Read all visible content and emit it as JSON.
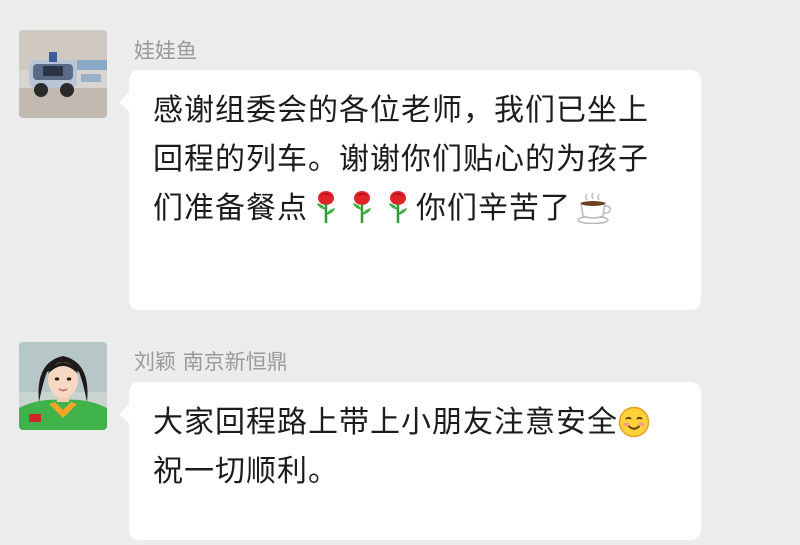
{
  "chat": {
    "messages": [
      {
        "sender": "娃娃鱼",
        "avatar": "toy-car-photo",
        "text_parts": [
          "感谢组委会的各位老师，我们已坐上回程的列车。谢谢你们贴心的为孩子们准备餐点",
          "你们辛苦了"
        ],
        "emojis": [
          "rose-emoji",
          "rose-emoji",
          "rose-emoji",
          "coffee-emoji"
        ]
      },
      {
        "sender": "刘颖 南京新恒鼎",
        "avatar": "woman-photo",
        "text_parts": [
          "大家回程路上带上小朋友注意安全",
          "祝一切顺利。"
        ],
        "emojis": [
          "smile-emoji"
        ]
      }
    ]
  },
  "colors": {
    "background": "#ececec",
    "bubble": "#ffffff",
    "sender_name": "#9a9a9a",
    "message_text": "#1c1c1c"
  }
}
